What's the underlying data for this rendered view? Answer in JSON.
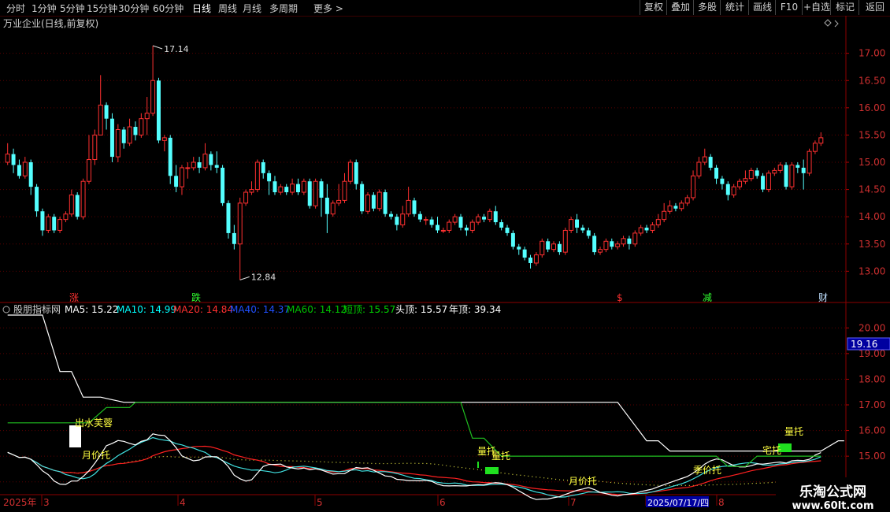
{
  "toolbar": {
    "periods": [
      "分时",
      "1分钟",
      "5分钟",
      "15分钟",
      "30分钟",
      "60分钟",
      "日线",
      "周线",
      "月线",
      "多周期",
      "更多 >"
    ],
    "active_period": "日线",
    "right_buttons": [
      "复权",
      "叠加",
      "多股",
      "统计",
      "画线",
      "F10",
      "+自选",
      "标记",
      "返回"
    ]
  },
  "header": {
    "title": "万业企业(日线,前复权)"
  },
  "indicator": {
    "name": "股朋指标网",
    "values": [
      {
        "label": "MA5: 15.22",
        "color": "#ffffff"
      },
      {
        "label": "MA10: 14.99",
        "color": "#00ffff"
      },
      {
        "label": "MA20: 14.84",
        "color": "#ff3030"
      },
      {
        "label": "MA40: 14.37",
        "color": "#2050ff"
      },
      {
        "label": "MA60: 14.12",
        "color": "#00c000"
      },
      {
        "label": "短顶: 15.57",
        "color": "#00d000"
      },
      {
        "label": "头顶: 15.57",
        "color": "#ffffff"
      },
      {
        "label": "年顶: 39.34",
        "color": "#ffffff"
      }
    ],
    "current_value_tag": "19.16"
  },
  "annotations": {
    "high_label": "17.14",
    "low_label": "12.84",
    "markers": [
      {
        "text": "涨",
        "color": "#ff3030"
      },
      {
        "text": "跌",
        "color": "#30ff30"
      },
      {
        "text": "$",
        "color": "#ff3030"
      },
      {
        "text": "减",
        "color": "#30ff30"
      },
      {
        "text": "财",
        "color": "#c0e0ff"
      }
    ],
    "lower_texts": [
      "出水芙蓉",
      "月价托",
      "量托",
      "量托",
      "月价托",
      "季价托",
      "量托",
      "宅托"
    ]
  },
  "xaxis": {
    "labels": [
      "2025年",
      "3",
      "4",
      "5",
      "6",
      "7",
      "2025/07/17/四",
      "8"
    ]
  },
  "watermark": {
    "line1": "乐淘公式网",
    "line2": "www.60lt.com"
  },
  "chart_data": {
    "type": "candlestick",
    "upper_axis": {
      "ylim": [
        12.6,
        17.4
      ],
      "ticks": [
        13.0,
        13.5,
        14.0,
        14.5,
        15.0,
        15.5,
        16.0,
        16.5,
        17.0
      ]
    },
    "lower_axis": {
      "ylim": [
        13.5,
        20.5
      ],
      "ticks": [
        14.0,
        15.0,
        16.0,
        17.0,
        18.0,
        19.0,
        20.0
      ]
    },
    "candles": [
      [
        15.0,
        15.15,
        14.95,
        15.35
      ],
      [
        15.15,
        14.95,
        14.8,
        15.25
      ],
      [
        14.95,
        14.75,
        14.7,
        15.05
      ],
      [
        14.75,
        15.0,
        14.7,
        15.1
      ],
      [
        15.0,
        14.55,
        14.4,
        15.05
      ],
      [
        14.55,
        14.1,
        14.0,
        14.6
      ],
      [
        14.1,
        13.75,
        13.65,
        14.15
      ],
      [
        13.75,
        14.0,
        13.7,
        14.05
      ],
      [
        14.0,
        13.75,
        13.7,
        14.05
      ],
      [
        13.75,
        13.95,
        13.7,
        14.0
      ],
      [
        13.95,
        14.05,
        13.9,
        14.1
      ],
      [
        14.05,
        14.4,
        14.0,
        14.5
      ],
      [
        14.4,
        14.0,
        13.95,
        14.45
      ],
      [
        14.0,
        14.65,
        13.95,
        14.7
      ],
      [
        14.65,
        15.05,
        14.6,
        15.5
      ],
      [
        15.05,
        15.5,
        14.95,
        15.6
      ],
      [
        15.5,
        16.05,
        15.5,
        16.6
      ],
      [
        16.05,
        15.8,
        15.6,
        16.1
      ],
      [
        15.8,
        15.1,
        15.0,
        15.9
      ],
      [
        15.1,
        15.6,
        15.0,
        15.7
      ],
      [
        15.6,
        15.35,
        15.25,
        15.65
      ],
      [
        15.35,
        15.65,
        15.3,
        15.8
      ],
      [
        15.65,
        15.5,
        15.4,
        15.75
      ],
      [
        15.5,
        15.8,
        15.45,
        15.9
      ],
      [
        15.8,
        15.9,
        15.5,
        16.2
      ],
      [
        15.9,
        16.5,
        15.85,
        17.14
      ],
      [
        16.5,
        15.4,
        15.35,
        16.55
      ],
      [
        15.4,
        15.45,
        15.2,
        15.5
      ],
      [
        15.45,
        14.75,
        14.6,
        15.5
      ],
      [
        14.75,
        14.55,
        14.45,
        14.95
      ],
      [
        14.55,
        14.9,
        14.4,
        14.95
      ],
      [
        14.9,
        14.9,
        14.7,
        15.0
      ],
      [
        14.9,
        15.0,
        14.85,
        15.1
      ],
      [
        15.0,
        14.9,
        14.8,
        15.1
      ],
      [
        14.9,
        15.15,
        14.85,
        15.35
      ],
      [
        15.15,
        14.95,
        14.85,
        15.2
      ],
      [
        14.95,
        14.9,
        14.8,
        15.2
      ],
      [
        14.9,
        14.25,
        14.2,
        14.95
      ],
      [
        14.25,
        13.7,
        13.6,
        14.3
      ],
      [
        13.7,
        13.5,
        13.4,
        13.85
      ],
      [
        13.5,
        14.25,
        12.84,
        14.35
      ],
      [
        14.25,
        14.45,
        14.2,
        14.5
      ],
      [
        14.45,
        14.5,
        14.4,
        14.65
      ],
      [
        14.5,
        15.0,
        14.45,
        15.05
      ],
      [
        15.0,
        14.8,
        14.7,
        15.05
      ],
      [
        14.8,
        14.65,
        14.4,
        14.85
      ],
      [
        14.65,
        14.45,
        14.4,
        14.75
      ],
      [
        14.45,
        14.55,
        14.4,
        14.6
      ],
      [
        14.55,
        14.45,
        14.4,
        14.6
      ],
      [
        14.45,
        14.6,
        14.4,
        14.7
      ],
      [
        14.6,
        14.45,
        14.4,
        14.7
      ],
      [
        14.45,
        14.65,
        14.4,
        14.7
      ],
      [
        14.65,
        14.2,
        14.15,
        14.7
      ],
      [
        14.2,
        14.65,
        14.15,
        14.7
      ],
      [
        14.65,
        14.35,
        14.0,
        14.7
      ],
      [
        14.35,
        14.05,
        13.7,
        14.6
      ],
      [
        14.05,
        14.25,
        14.0,
        14.3
      ],
      [
        14.25,
        14.3,
        14.2,
        14.6
      ],
      [
        14.3,
        14.65,
        14.25,
        14.8
      ],
      [
        14.65,
        15.0,
        14.6,
        15.05
      ],
      [
        15.0,
        14.6,
        14.5,
        15.05
      ],
      [
        14.6,
        14.1,
        14.05,
        14.65
      ],
      [
        14.1,
        14.4,
        14.05,
        14.45
      ],
      [
        14.4,
        14.15,
        14.1,
        14.45
      ],
      [
        14.15,
        14.45,
        14.1,
        14.5
      ],
      [
        14.45,
        14.05,
        14.0,
        14.5
      ],
      [
        14.05,
        14.0,
        13.95,
        14.1
      ],
      [
        14.0,
        13.85,
        13.75,
        14.05
      ],
      [
        13.85,
        14.05,
        13.8,
        14.2
      ],
      [
        14.05,
        14.3,
        14.0,
        14.55
      ],
      [
        14.3,
        14.05,
        14.0,
        14.35
      ],
      [
        14.05,
        13.95,
        13.9,
        14.1
      ],
      [
        13.95,
        13.95,
        13.85,
        14.0
      ],
      [
        13.95,
        13.85,
        13.8,
        14.0
      ],
      [
        13.85,
        13.75,
        13.7,
        14.0
      ],
      [
        13.75,
        13.75,
        13.7,
        13.8
      ],
      [
        13.75,
        13.9,
        13.7,
        13.95
      ],
      [
        13.9,
        14.0,
        13.85,
        14.05
      ],
      [
        14.0,
        13.8,
        13.75,
        14.05
      ],
      [
        13.8,
        13.75,
        13.65,
        13.85
      ],
      [
        13.75,
        13.9,
        13.7,
        13.95
      ],
      [
        13.9,
        14.0,
        13.85,
        14.05
      ],
      [
        14.0,
        13.95,
        13.9,
        14.05
      ],
      [
        13.95,
        14.1,
        13.9,
        14.15
      ],
      [
        14.1,
        13.9,
        13.85,
        14.2
      ],
      [
        13.9,
        13.8,
        13.75,
        13.95
      ],
      [
        13.8,
        13.7,
        13.65,
        13.85
      ],
      [
        13.7,
        13.45,
        13.4,
        13.75
      ],
      [
        13.45,
        13.4,
        13.3,
        13.5
      ],
      [
        13.4,
        13.25,
        13.2,
        13.45
      ],
      [
        13.25,
        13.15,
        13.05,
        13.3
      ],
      [
        13.15,
        13.3,
        13.1,
        13.35
      ],
      [
        13.3,
        13.55,
        13.25,
        13.6
      ],
      [
        13.55,
        13.4,
        13.35,
        13.6
      ],
      [
        13.4,
        13.5,
        13.35,
        13.55
      ],
      [
        13.5,
        13.35,
        13.3,
        13.55
      ],
      [
        13.35,
        13.75,
        13.3,
        13.8
      ],
      [
        13.75,
        13.95,
        13.7,
        14.0
      ],
      [
        13.95,
        13.8,
        13.7,
        14.05
      ],
      [
        13.8,
        13.75,
        13.7,
        13.85
      ],
      [
        13.75,
        13.65,
        13.6,
        13.8
      ],
      [
        13.65,
        13.35,
        13.3,
        13.7
      ],
      [
        13.35,
        13.4,
        13.3,
        13.45
      ],
      [
        13.4,
        13.55,
        13.35,
        13.6
      ],
      [
        13.55,
        13.45,
        13.4,
        13.6
      ],
      [
        13.45,
        13.5,
        13.4,
        13.55
      ],
      [
        13.5,
        13.6,
        13.45,
        13.65
      ],
      [
        13.6,
        13.5,
        13.4,
        13.65
      ],
      [
        13.5,
        13.7,
        13.45,
        13.75
      ],
      [
        13.7,
        13.8,
        13.65,
        13.85
      ],
      [
        13.8,
        13.75,
        13.7,
        13.85
      ],
      [
        13.75,
        13.85,
        13.7,
        13.9
      ],
      [
        13.85,
        13.95,
        13.8,
        14.05
      ],
      [
        13.95,
        14.1,
        13.9,
        14.25
      ],
      [
        14.1,
        14.2,
        14.05,
        14.3
      ],
      [
        14.2,
        14.15,
        14.1,
        14.25
      ],
      [
        14.15,
        14.25,
        14.1,
        14.3
      ],
      [
        14.25,
        14.35,
        14.2,
        14.4
      ],
      [
        14.35,
        14.75,
        14.3,
        14.85
      ],
      [
        14.75,
        15.0,
        14.7,
        15.1
      ],
      [
        15.0,
        15.1,
        14.95,
        15.25
      ],
      [
        15.1,
        14.9,
        14.85,
        15.15
      ],
      [
        14.9,
        14.7,
        14.6,
        14.95
      ],
      [
        14.7,
        14.6,
        14.5,
        14.75
      ],
      [
        14.6,
        14.4,
        14.3,
        14.65
      ],
      [
        14.4,
        14.55,
        14.35,
        14.6
      ],
      [
        14.55,
        14.65,
        14.5,
        14.7
      ],
      [
        14.65,
        14.7,
        14.6,
        14.85
      ],
      [
        14.7,
        14.85,
        14.65,
        14.9
      ],
      [
        14.85,
        14.75,
        14.7,
        14.9
      ],
      [
        14.75,
        14.5,
        14.45,
        14.8
      ],
      [
        14.5,
        14.8,
        14.45,
        14.85
      ],
      [
        14.8,
        14.85,
        14.75,
        14.9
      ],
      [
        14.85,
        14.95,
        14.8,
        15.0
      ],
      [
        14.95,
        14.55,
        14.5,
        15.0
      ],
      [
        14.55,
        14.95,
        14.5,
        15.0
      ],
      [
        14.95,
        14.9,
        14.8,
        15.0
      ],
      [
        14.9,
        14.8,
        14.5,
        15.05
      ],
      [
        14.8,
        15.2,
        14.75,
        15.25
      ],
      [
        15.2,
        15.35,
        15.15,
        15.4
      ],
      [
        15.35,
        15.45,
        15.3,
        15.55
      ]
    ]
  }
}
